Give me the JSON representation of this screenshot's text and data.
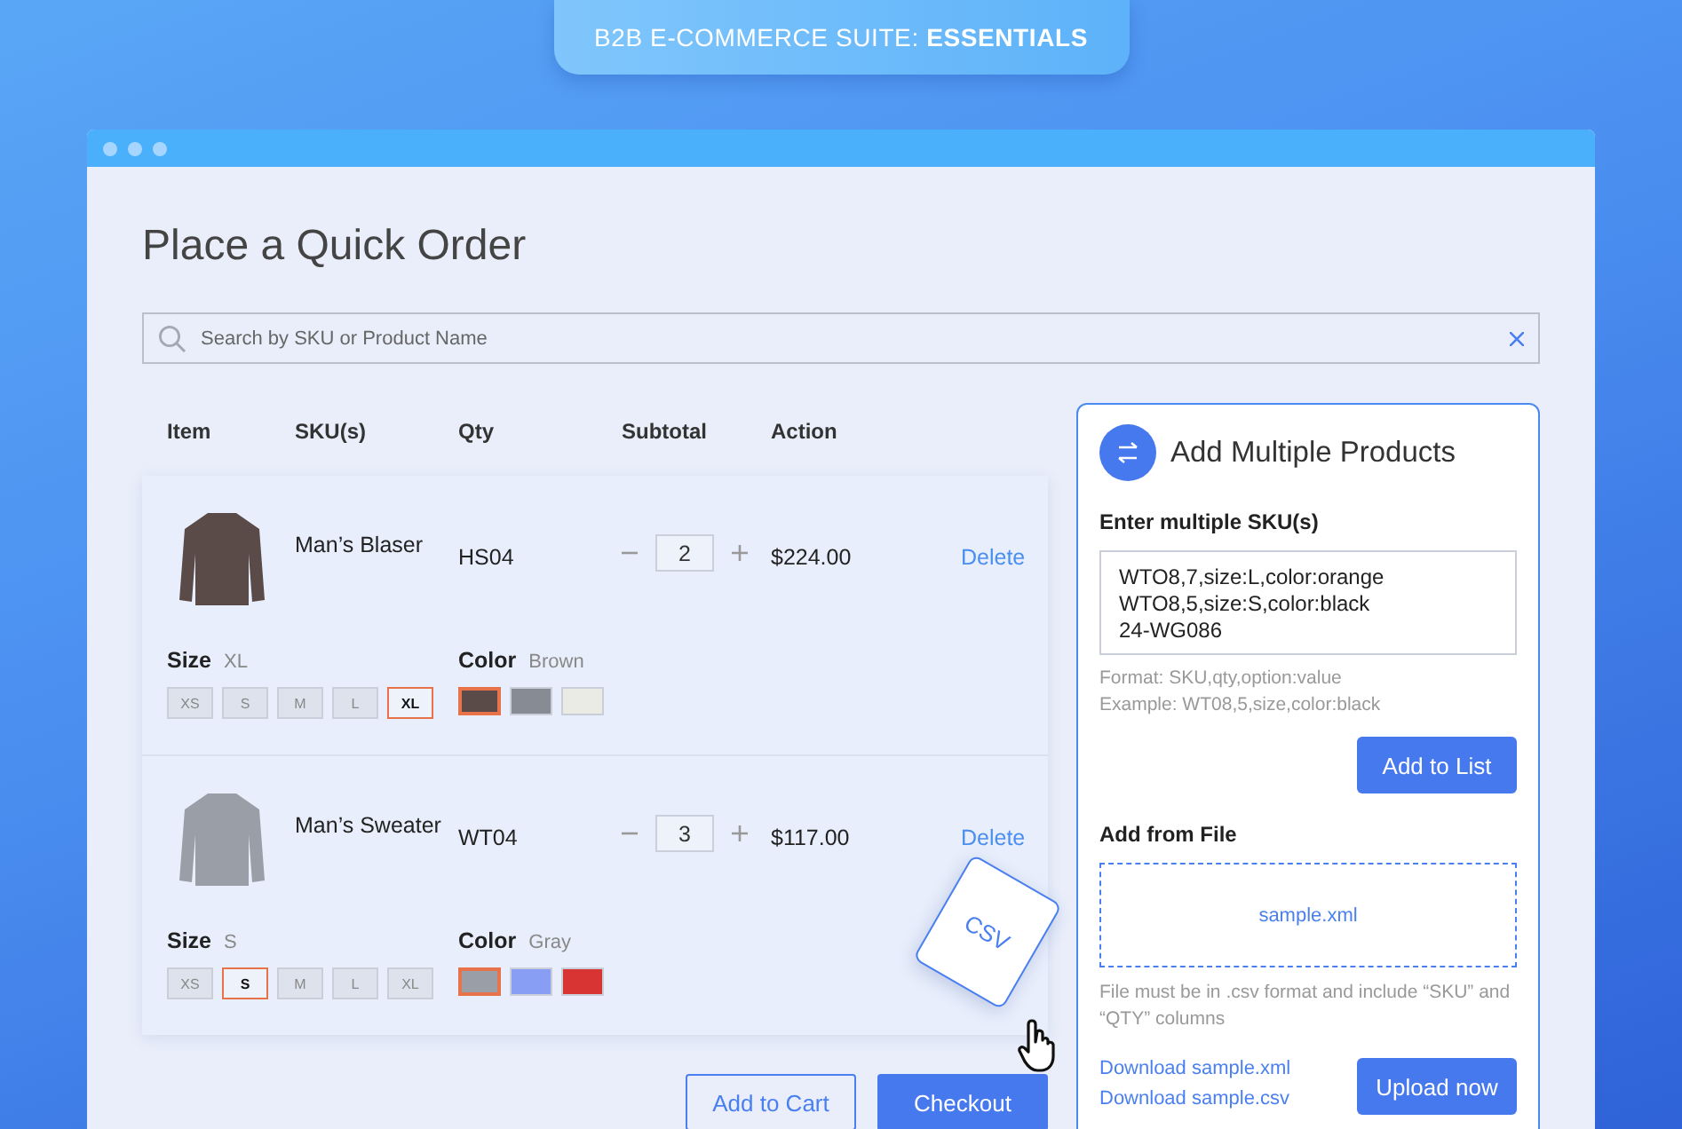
{
  "banner": {
    "text": "B2B E-COMMERCE SUITE: **ESSENTIALS**"
  },
  "page": {
    "title": "Place a Quick Order"
  },
  "search": {
    "placeholder": "Search by SKU or Product Name"
  },
  "table": {
    "columns": [
      "Item",
      "SKU(s)",
      "Qty",
      "Subtotal",
      "Action"
    ],
    "rows": [
      {
        "name": "Man’s Blaser",
        "sku": "HS04",
        "qty": "2",
        "subtotal": "$224.00",
        "action": "Delete",
        "size_label": "Size",
        "size_value": "XL",
        "sizes": [
          {
            "label": "XS",
            "selected": false
          },
          {
            "label": "S",
            "selected": false
          },
          {
            "label": "M",
            "selected": false
          },
          {
            "label": "L",
            "selected": false
          },
          {
            "label": "XL",
            "selected": true
          }
        ],
        "color_label": "Color",
        "color_value": "Brown",
        "swatches": [
          {
            "color": "#5a4a48",
            "selected": true
          },
          {
            "color": "#868b94",
            "selected": false
          },
          {
            "color": "#ebebe6",
            "selected": false
          }
        ]
      },
      {
        "name": "Man’s Sweater",
        "sku": "WT04",
        "qty": "3",
        "subtotal": "$117.00",
        "action": "Delete",
        "size_label": "Size",
        "size_value": "S",
        "sizes": [
          {
            "label": "XS",
            "selected": false
          },
          {
            "label": "S",
            "selected": true
          },
          {
            "label": "M",
            "selected": false
          },
          {
            "label": "L",
            "selected": false
          },
          {
            "label": "XL",
            "selected": false
          }
        ],
        "color_label": "Color",
        "color_value": "Gray",
        "swatches": [
          {
            "color": "#9a9ea6",
            "selected": true
          },
          {
            "color": "#889ef5",
            "selected": false
          },
          {
            "color": "#d93434",
            "selected": false
          }
        ]
      }
    ]
  },
  "cart_buttons": [
    "Add to Cart",
    "Checkout"
  ],
  "panel": {
    "title": "Add Multiple Products",
    "sku_label": "Enter multiple SKU(s)",
    "sku_value": "WTO8,7,size:L,color:orange\nWTO8,5,size:S,color:black\n24-WG086",
    "hints": [
      "Format: SKU,qty,option:value",
      "Example: WT08,5,size,color:black"
    ],
    "add_button": "Add to List",
    "file_label": "Add from File",
    "drop_file": "sample.xml",
    "file_note": "File must be in .csv format and include “SKU” and “QTY” columns",
    "links": [
      "Download sample.xml",
      "Download sample.csv"
    ],
    "upload_button": "Upload now"
  },
  "drag_card": {
    "label": "CSV"
  }
}
